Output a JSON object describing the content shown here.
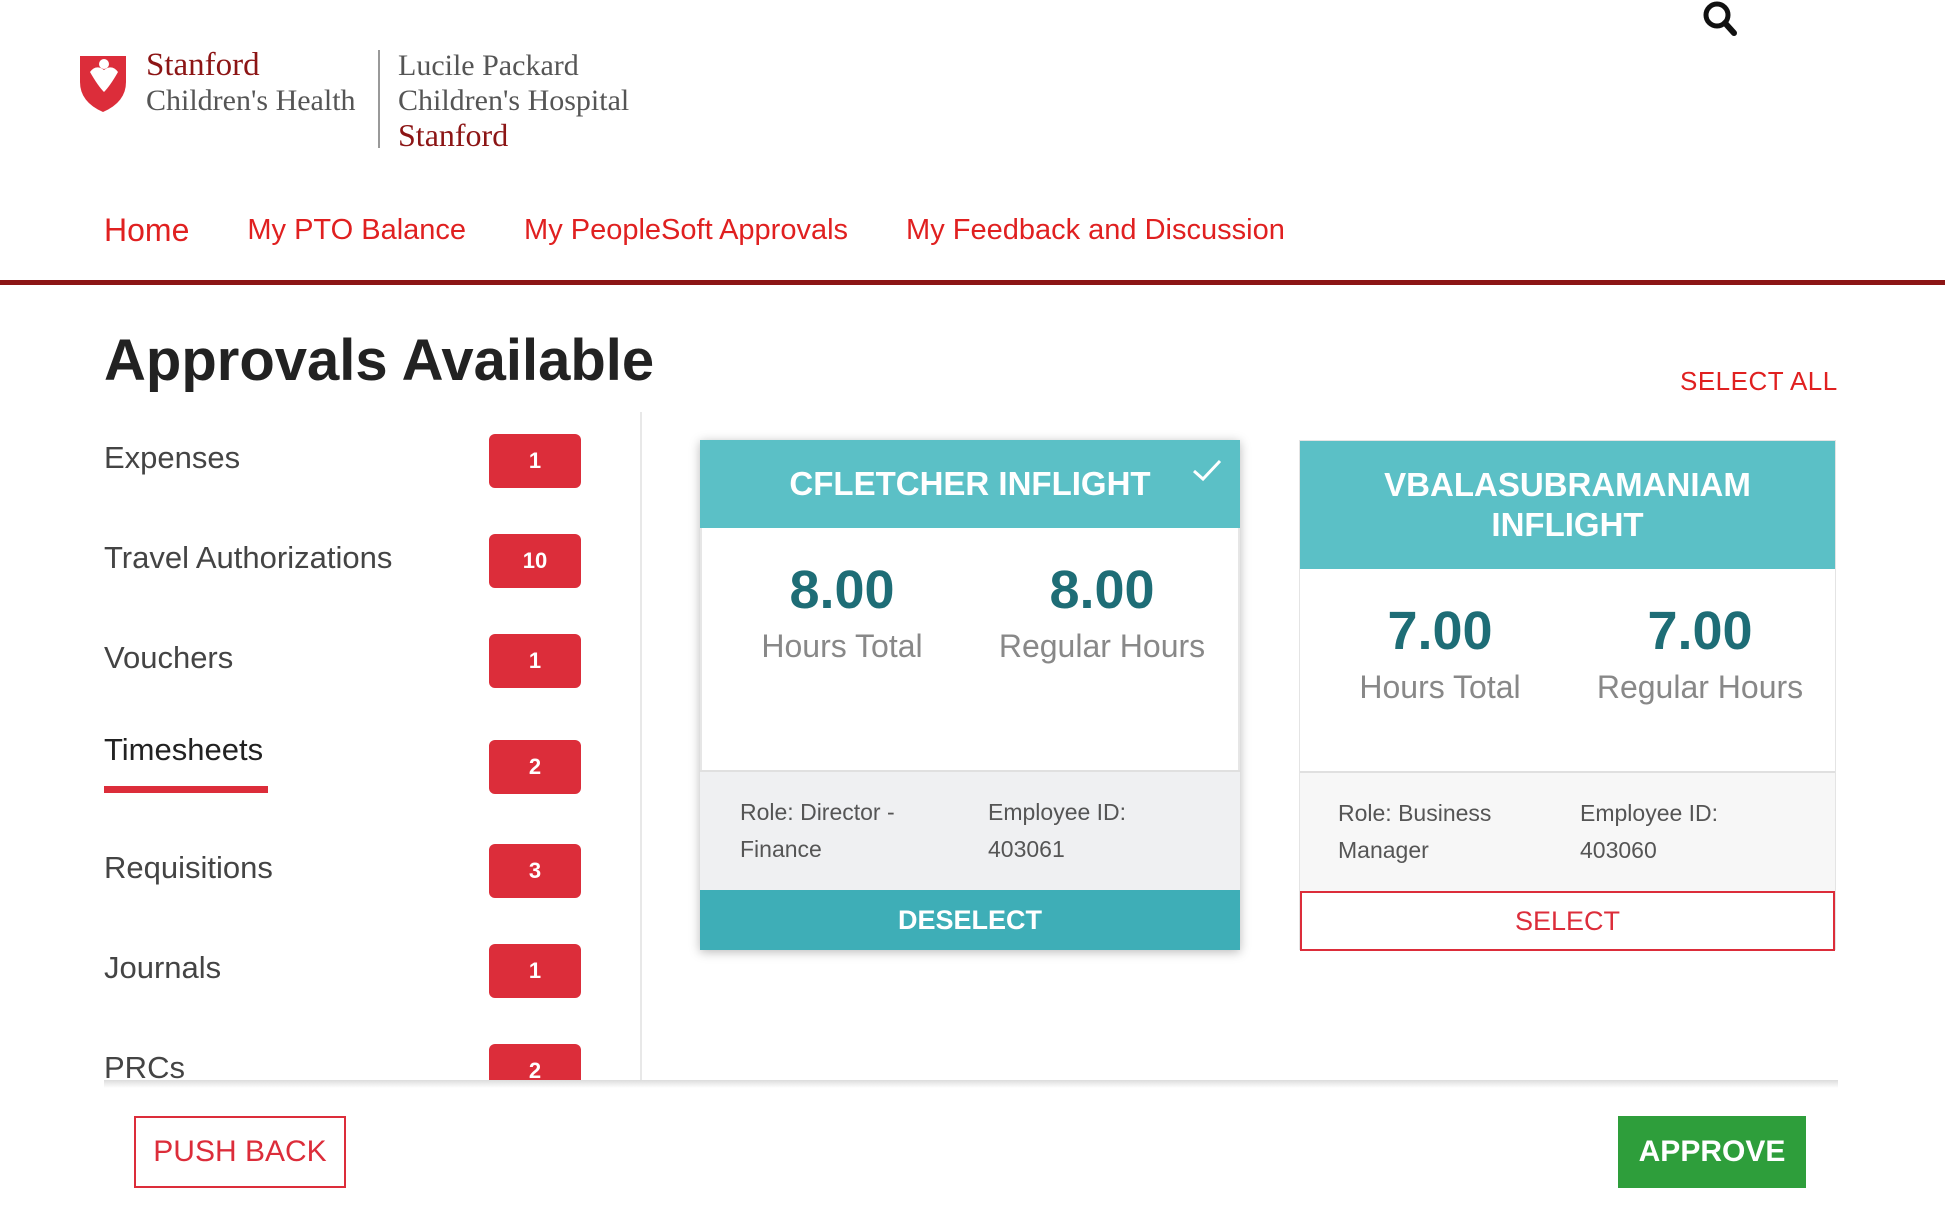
{
  "header": {
    "logo_left": {
      "line1": "Stanford",
      "line2": "Children's Health"
    },
    "logo_right": {
      "line1": "Lucile Packard",
      "line2": "Children's Hospital",
      "line3": "Stanford"
    },
    "search_icon": "search-icon"
  },
  "nav": {
    "items": [
      {
        "label": "Home"
      },
      {
        "label": "My PTO Balance"
      },
      {
        "label": "My PeopleSoft Approvals"
      },
      {
        "label": "My Feedback and Discussion"
      }
    ]
  },
  "page": {
    "title": "Approvals Available",
    "select_all": "SELECT ALL"
  },
  "sidebar": {
    "items": [
      {
        "label": "Expenses",
        "count": "1"
      },
      {
        "label": "Travel Authorizations",
        "count": "10"
      },
      {
        "label": "Vouchers",
        "count": "1"
      },
      {
        "label": "Timesheets",
        "count": "2",
        "active": true
      },
      {
        "label": "Requisitions",
        "count": "3"
      },
      {
        "label": "Journals",
        "count": "1"
      },
      {
        "label": "PRCs",
        "count": "2"
      }
    ]
  },
  "cards": [
    {
      "title": "CFLETCHER INFLIGHT",
      "selected": true,
      "hours_total": "8.00",
      "hours_total_label": "Hours Total",
      "regular_hours": "8.00",
      "regular_hours_label": "Regular Hours",
      "role_line1": "Role: Director -",
      "role_line2": "Finance",
      "employee_line1": "Employee ID:",
      "employee_line2": "403061",
      "button": "DESELECT"
    },
    {
      "title_line1": "VBALASUBRAMANIAM",
      "title_line2": "INFLIGHT",
      "selected": false,
      "hours_total": "7.00",
      "hours_total_label": "Hours Total",
      "regular_hours": "7.00",
      "regular_hours_label": "Regular Hours",
      "role_line1": "Role: Business",
      "role_line2": "Manager",
      "employee_line1": "Employee ID:",
      "employee_line2": "403060",
      "button": "SELECT"
    }
  ],
  "footer": {
    "push_back": "PUSH BACK",
    "approve": "APPROVE"
  },
  "colors": {
    "brand_red": "#dc2d3a",
    "stanford_cardinal": "#8c1515",
    "card_header_teal": "#5bc0c6",
    "deselect_teal": "#3eaeb7",
    "value_teal": "#1e6d76",
    "approve_green": "#2e9e3b"
  }
}
